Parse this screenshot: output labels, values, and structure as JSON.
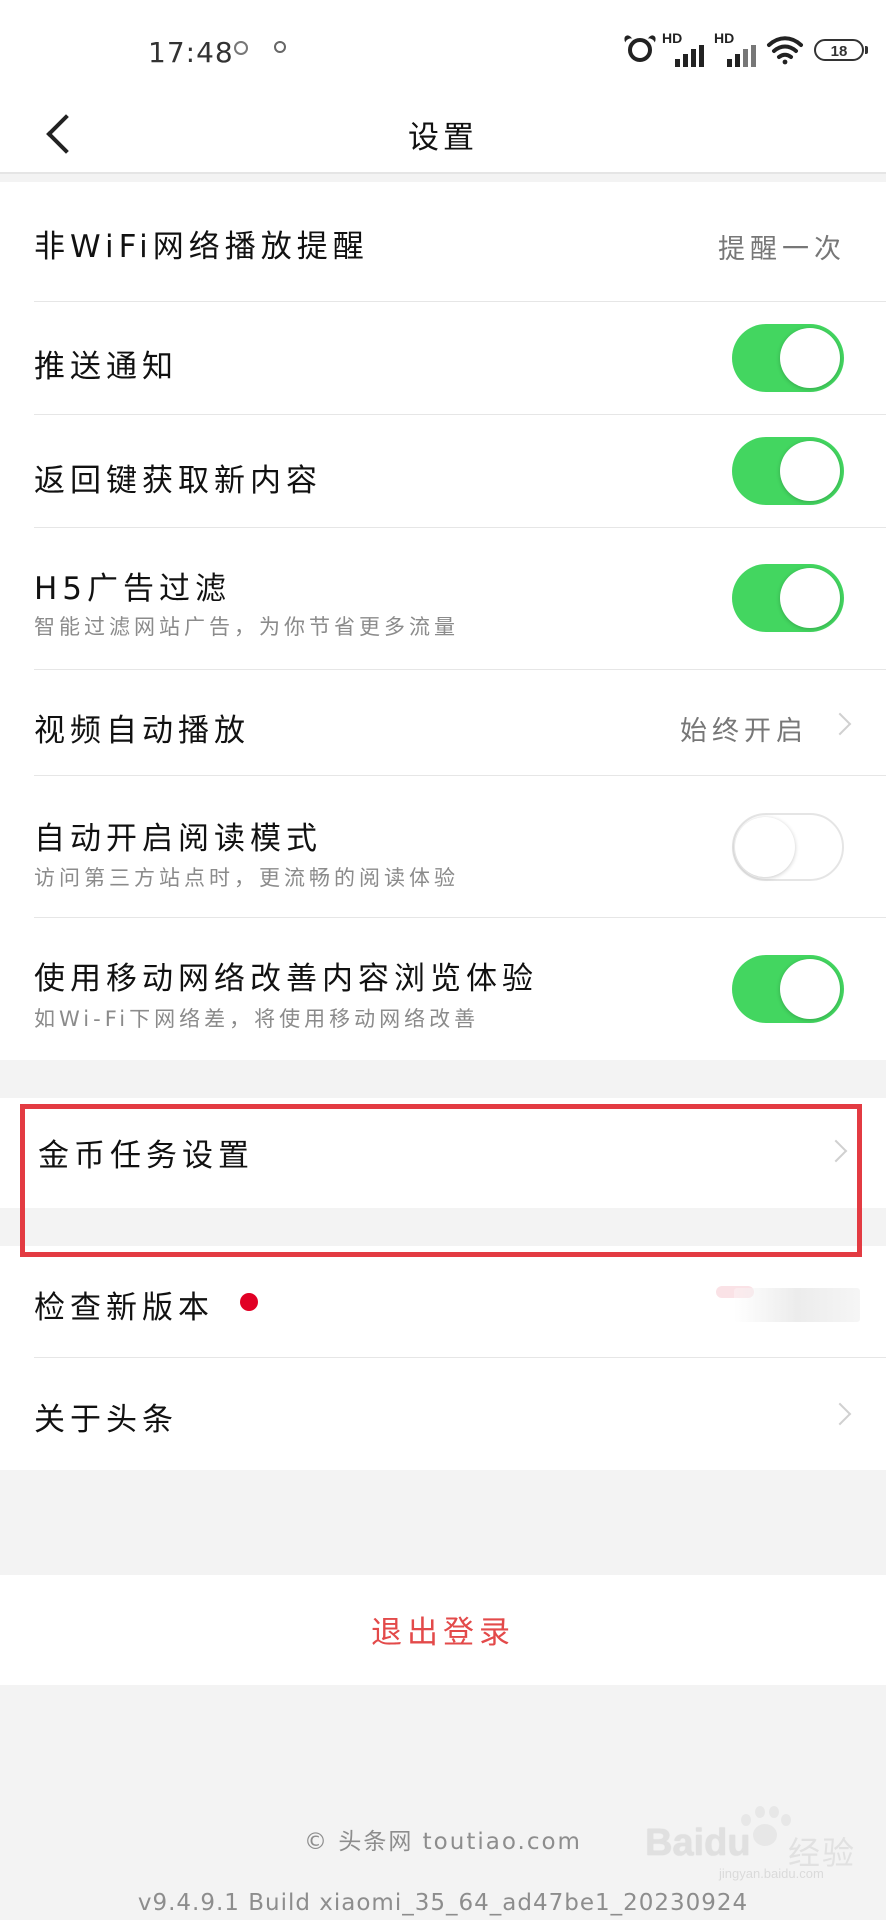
{
  "status_bar": {
    "time": "17:48",
    "battery": "18",
    "signal_1": "HD",
    "signal_2": "HD"
  },
  "header": {
    "title": "设置"
  },
  "settings": [
    {
      "label": "非WiFi网络播放提醒",
      "value": "提醒一次"
    },
    {
      "label": "推送通知",
      "toggle": "on"
    },
    {
      "label": "返回键获取新内容",
      "toggle": "on"
    },
    {
      "label": "H5广告过滤",
      "description": "智能过滤网站广告，为你节省更多流量",
      "toggle": "on"
    },
    {
      "label": "视频自动播放",
      "value": "始终开启"
    },
    {
      "label": "自动开启阅读模式",
      "description": "访问第三方站点时，更流畅的阅读体验",
      "toggle": "off"
    },
    {
      "label": "使用移动网络改善内容浏览体验",
      "description": "如Wi-Fi下网络差，将使用移动网络改善",
      "toggle": "on"
    }
  ],
  "gold_task": {
    "label": "金币任务设置"
  },
  "lower_items": [
    {
      "label": "检查新版本"
    },
    {
      "label": "关于头条"
    }
  ],
  "logout": {
    "label": "退出登录"
  },
  "footer": {
    "copyright": "© 头条网 toutiao.com",
    "version": "v9.4.9.1 Build xiaomi_35_64_ad47be1_20230924"
  },
  "watermark": {
    "brand": "Baidu",
    "text": "经验",
    "url": "jingyan.baidu.com"
  },
  "colors": {
    "toggle_on": "#43d660",
    "highlight": "#e33b42",
    "logout": "#e34a4a",
    "red_dot": "#e10025"
  },
  "icons": {
    "back": "chevron-left-icon",
    "alarm": "alarm-icon",
    "wifi": "wifi-icon",
    "battery": "battery-icon"
  }
}
